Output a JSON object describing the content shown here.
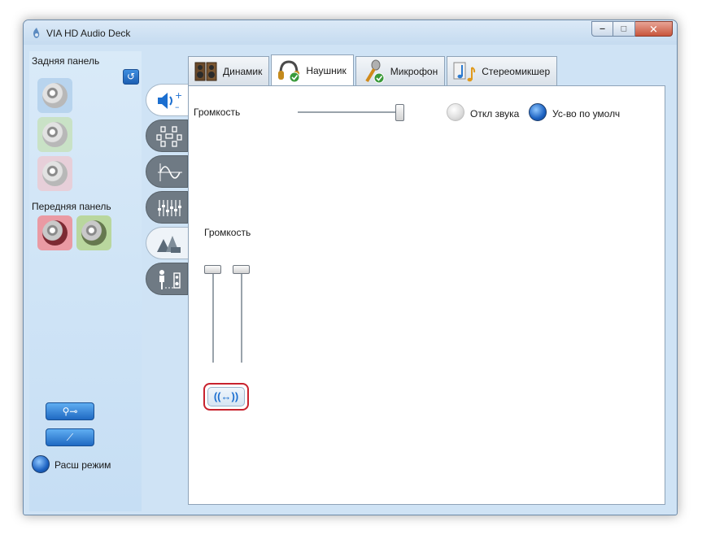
{
  "window": {
    "title": "VIA HD Audio Deck",
    "accent": "#1d63c2",
    "close_color": "#c8553c"
  },
  "left_panel": {
    "back_panel_label": "Задняя панель",
    "front_panel_label": "Передняя панель",
    "back_jacks": [
      {
        "name": "blue",
        "color": "#b8d4ee"
      },
      {
        "name": "green",
        "color": "#c9e2c6"
      },
      {
        "name": "pink",
        "color": "#e7cfd9"
      }
    ],
    "front_jacks": [
      {
        "name": "pink",
        "color": "#ea9aa3"
      },
      {
        "name": "green",
        "color": "#b9d79e"
      }
    ],
    "advanced_mode_label": "Расш режим"
  },
  "side_tabs": [
    "volume-icon",
    "speaker-config-icon",
    "sine-wave-icon",
    "equalizer-icon",
    "environment-icon",
    "room-correction-icon"
  ],
  "tabs": [
    {
      "label": "Динамик",
      "icon": "speakers-icon",
      "active": false
    },
    {
      "label": "Наушник",
      "icon": "headphones-icon",
      "active": true
    },
    {
      "label": "Микрофон",
      "icon": "microphone-icon",
      "active": false
    },
    {
      "label": "Стереомикшер",
      "icon": "music-note-icon",
      "active": false
    }
  ],
  "volume": {
    "label": "Громкость",
    "level": 1.0,
    "mute_label": "Откл звука",
    "default_device_label": "Ус-во по умолч"
  },
  "channel_volume": {
    "label": "Громкость",
    "left_level": 1.0,
    "right_level": 1.0,
    "link_label": "((↔))"
  }
}
